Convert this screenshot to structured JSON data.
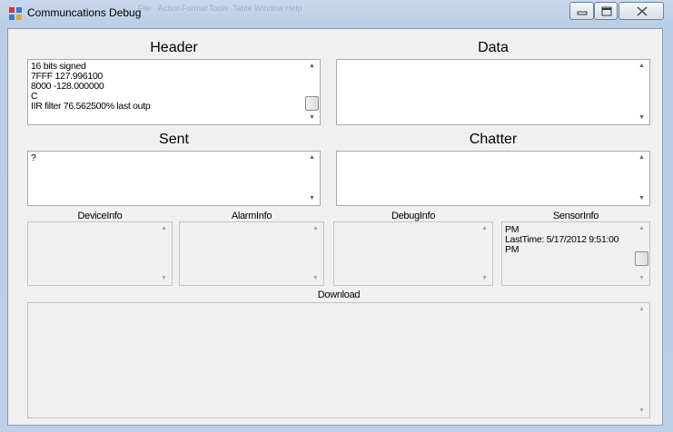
{
  "window": {
    "title": "Communcations Debug",
    "ghost_menu": [
      "File",
      "Action",
      "Format",
      "Tools",
      "Table",
      "Window",
      "Help"
    ]
  },
  "panels": {
    "header": {
      "label": "Header",
      "lines": [
        "16 bits signed",
        "7FFF 127.996100",
        "8000 -128.000000",
        "C",
        "IIR filter 76.562500% last outp"
      ]
    },
    "data": {
      "label": "Data",
      "lines": []
    },
    "sent": {
      "label": "Sent",
      "lines": [
        "?"
      ]
    },
    "chatter": {
      "label": "Chatter",
      "lines": []
    },
    "device_info": {
      "label": "DeviceInfo",
      "lines": []
    },
    "alarm_info": {
      "label": "AlarmInfo",
      "lines": []
    },
    "debug_info": {
      "label": "DebugInfo",
      "lines": []
    },
    "sensor_info": {
      "label": "SensorInfo",
      "lines": [
        "PM",
        "LastTime: 5/17/2012 9:51:00",
        "PM"
      ]
    },
    "download": {
      "label": "Download",
      "lines": []
    }
  },
  "colors": {
    "title_bar": "#c9d9ec",
    "client_bg": "#f0f0f0",
    "textbox_border": "#a9a9a9"
  },
  "icons": {
    "app": "app-icon",
    "minimize": "minimize-icon",
    "maximize": "maximize-icon",
    "close": "close-icon",
    "scroll_up": "scroll-up-arrow-icon",
    "scroll_down": "scroll-down-arrow-icon"
  }
}
